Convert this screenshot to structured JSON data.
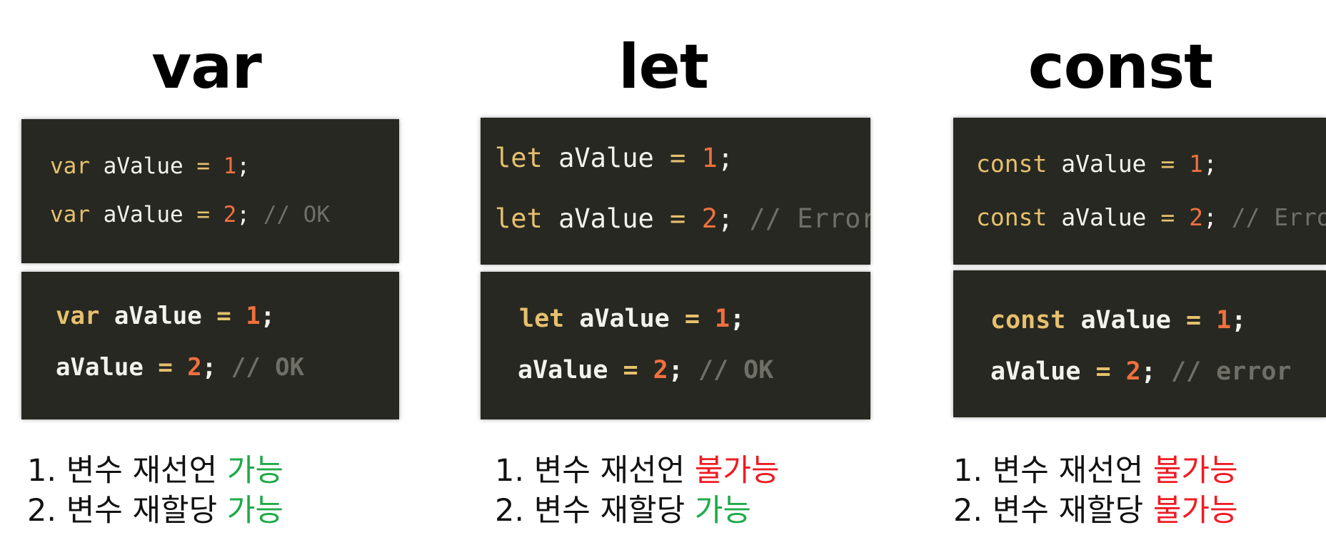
{
  "colors": {
    "code_bg": "#272822",
    "keyword": "#e6c06e",
    "number": "#f0703f",
    "comment": "#6f6f68",
    "possible": "#1faa4a",
    "impossible": "#ee1c24"
  },
  "columns": [
    {
      "title": "var",
      "redeclare": {
        "line1": {
          "keyword": "var",
          "name": "aValue",
          "op": "=",
          "value": "1",
          "end": ";"
        },
        "line2": {
          "keyword": "var",
          "name": "aValue",
          "op": "=",
          "value": "2",
          "end": ";",
          "comment": "// OK"
        }
      },
      "reassign": {
        "line1": {
          "keyword": "var",
          "name": "aValue",
          "op": "=",
          "value": "1",
          "end": ";"
        },
        "line2": {
          "name": "aValue",
          "op": "=",
          "value": "2",
          "end": ";",
          "comment": "// OK"
        }
      },
      "notes": [
        {
          "prefix": "1. 변수 재선언 ",
          "status": "가능",
          "status_type": "possible"
        },
        {
          "prefix": "2. 변수 재할당 ",
          "status": "가능",
          "status_type": "possible"
        }
      ]
    },
    {
      "title": "let",
      "redeclare": {
        "line1": {
          "keyword": "let",
          "name": "aValue",
          "op": "=",
          "value": "1",
          "end": ";"
        },
        "line2": {
          "keyword": "let",
          "name": "aValue",
          "op": "=",
          "value": "2",
          "end": ";",
          "comment": "// Error"
        }
      },
      "reassign": {
        "line1": {
          "keyword": "let",
          "name": "aValue",
          "op": "=",
          "value": "1",
          "end": ";"
        },
        "line2": {
          "name": "aValue",
          "op": "=",
          "value": "2",
          "end": ";",
          "comment": "// OK"
        }
      },
      "notes": [
        {
          "prefix": "1. 변수 재선언 ",
          "status": "불가능",
          "status_type": "impossible"
        },
        {
          "prefix": "2. 변수 재할당 ",
          "status": "가능",
          "status_type": "possible"
        }
      ]
    },
    {
      "title": "const",
      "redeclare": {
        "line1": {
          "keyword": "const",
          "name": "aValue",
          "op": "=",
          "value": "1",
          "end": ";"
        },
        "line2": {
          "keyword": "const",
          "name": "aValue",
          "op": "=",
          "value": "2",
          "end": ";",
          "comment": "// Error"
        }
      },
      "reassign": {
        "line1": {
          "keyword": "const",
          "name": "aValue",
          "op": "=",
          "value": "1",
          "end": ";"
        },
        "line2": {
          "name": "aValue",
          "op": "=",
          "value": "2",
          "end": ";",
          "comment": "// error"
        }
      },
      "notes": [
        {
          "prefix": "1. 변수 재선언 ",
          "status": "불가능",
          "status_type": "impossible"
        },
        {
          "prefix": "2. 변수 재할당 ",
          "status": "불가능",
          "status_type": "impossible"
        }
      ]
    }
  ]
}
